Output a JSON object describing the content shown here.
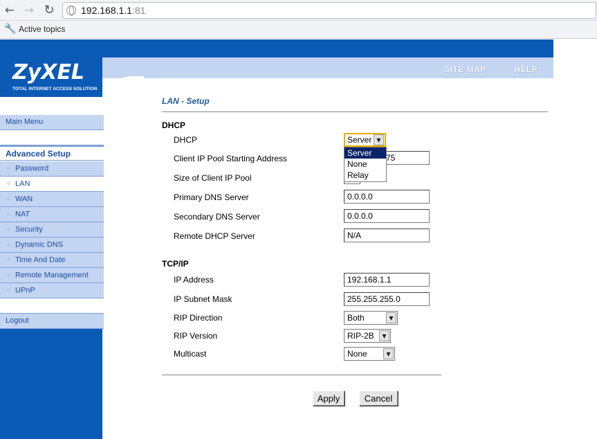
{
  "browser": {
    "url_host": "192.168.1.1",
    "url_port": ":81",
    "bookmark": "Active topics"
  },
  "brand": {
    "logo": "ZyXEL",
    "tagline": "TOTAL INTERNET ACCESS SOLUTION",
    "accent": "#0b5ab6"
  },
  "header": {
    "site_map": "SITE MAP",
    "help": "HELP"
  },
  "sidebar": {
    "main_menu": "Main Menu",
    "advanced_setup": "Advanced Setup",
    "items": [
      "Password",
      "LAN",
      "WAN",
      "NAT",
      "Security",
      "Dynamic DNS",
      "Time And Date",
      "Remote Management",
      "UPnP"
    ],
    "logout": "Logout"
  },
  "page": {
    "title": "LAN - Setup"
  },
  "dhcp": {
    "section": "DHCP",
    "dhcp_label": "DHCP",
    "dhcp_value": "Server",
    "dhcp_options": [
      "Server",
      "None",
      "Relay"
    ],
    "pool_start_label": "Client IP Pool Starting Address",
    "pool_start_value": "75",
    "pool_size_label": "Size of Client IP Pool",
    "primary_dns_label": "Primary DNS Server",
    "primary_dns_value": "0.0.0.0",
    "secondary_dns_label": "Secondary DNS Server",
    "secondary_dns_value": "0.0.0.0",
    "remote_dhcp_label": "Remote DHCP Server",
    "remote_dhcp_value": "N/A"
  },
  "tcpip": {
    "section": "TCP/IP",
    "ip_label": "IP Address",
    "ip_value": "192.168.1.1",
    "mask_label": "IP Subnet Mask",
    "mask_value": "255.255.255.0",
    "rip_dir_label": "RIP Direction",
    "rip_dir_value": "Both",
    "rip_ver_label": "RIP Version",
    "rip_ver_value": "RIP-2B",
    "multicast_label": "Multicast",
    "multicast_value": "None"
  },
  "actions": {
    "apply": "Apply",
    "cancel": "Cancel"
  }
}
